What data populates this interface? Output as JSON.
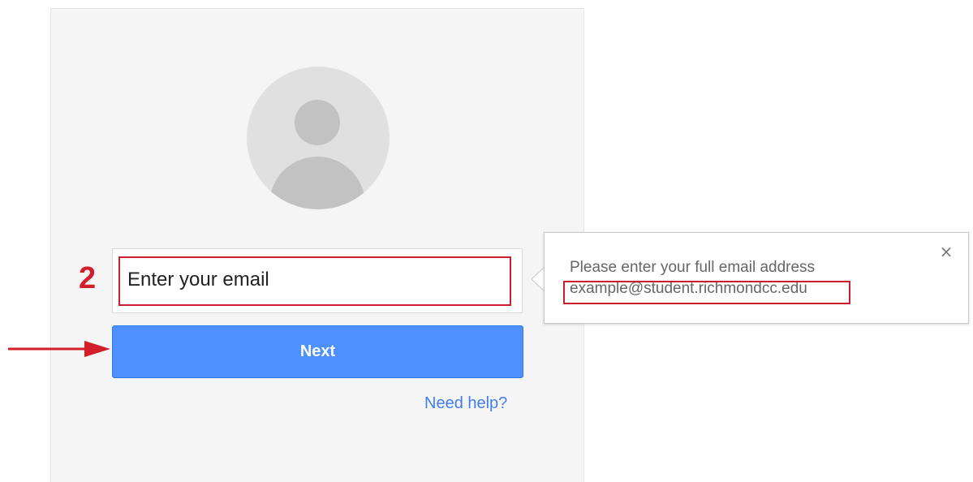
{
  "login": {
    "email_placeholder": "Enter your email",
    "next_label": "Next",
    "need_help_label": "Need help?"
  },
  "annotation": {
    "step_number": "2",
    "highlight_color": "#cc1f2e"
  },
  "tooltip": {
    "message": "Please enter your full email address",
    "example": "example@student.richmondcc.edu",
    "close_icon": "close-icon"
  },
  "colors": {
    "card_background": "#f5f5f5",
    "primary_button": "#4d90fe",
    "link": "#427fed",
    "avatar_background": "#e0e0e0",
    "avatar_figure": "#c2c2c2"
  }
}
